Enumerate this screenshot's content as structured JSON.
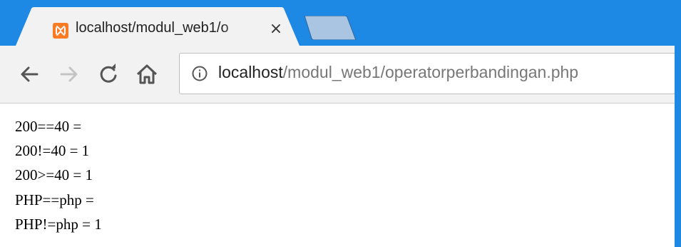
{
  "browser": {
    "tab": {
      "title": "localhost/modul_web1/o",
      "close_glyph": "×",
      "favicon": "xampp-icon"
    },
    "new_tab_button": "new-tab-icon",
    "toolbar": {
      "back": "back-arrow-icon",
      "forward": "forward-arrow-icon",
      "reload": "reload-icon",
      "home": "home-icon"
    },
    "omnibox": {
      "info_icon": "info-icon",
      "host": "localhost",
      "path": "/modul_web1/operatorperbandingan.php"
    },
    "colors": {
      "frame": "#1e88e5",
      "toolbar": "#f2f2f2",
      "favicon": "#fb7a24"
    }
  },
  "page": {
    "lines": [
      "200==40 =",
      "200!=40 = 1",
      "200>=40 = 1",
      "PHP==php =",
      "PHP!=php = 1"
    ]
  }
}
